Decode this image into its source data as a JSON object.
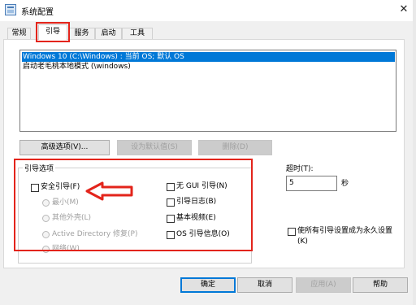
{
  "window": {
    "title": "系统配置",
    "close_glyph": "✕"
  },
  "tabs": [
    {
      "label": "常规",
      "active": false
    },
    {
      "label": "引导",
      "active": true
    },
    {
      "label": "服务",
      "active": false
    },
    {
      "label": "启动",
      "active": false
    },
    {
      "label": "工具",
      "active": false
    }
  ],
  "os_list": {
    "items": [
      {
        "text": "Windows 10 (C:\\Windows) : 当前 OS; 默认 OS",
        "selected": true
      },
      {
        "text": "启动老毛桃本地模式 (\\windows)",
        "selected": false
      }
    ]
  },
  "list_buttons": {
    "advanced": "高级选项(V)...",
    "set_default": "设为默认值(S)",
    "delete": "删除(D)"
  },
  "boot_options": {
    "group_title": "引导选项",
    "safe_boot": "安全引导(F)",
    "minimal": "最小(M)",
    "alternate_shell": "其他外壳(L)",
    "ad_repair": "Active Directory 修复(P)",
    "network": "网络(W)",
    "no_gui": "无 GUI 引导(N)",
    "boot_log": "引导日志(B)",
    "base_video": "基本视频(E)",
    "os_boot_info": "OS 引导信息(O)"
  },
  "timeout": {
    "label": "超时(T):",
    "value": "5",
    "unit": "秒"
  },
  "permanent": {
    "line1": "使所有引导设置成为永久设置",
    "line2": "(K)"
  },
  "dialog_buttons": {
    "ok": "确定",
    "cancel": "取消",
    "apply": "应用(A)",
    "help": "帮助"
  },
  "annotation_color": "#e3241b",
  "selection_color": "#0078d7"
}
